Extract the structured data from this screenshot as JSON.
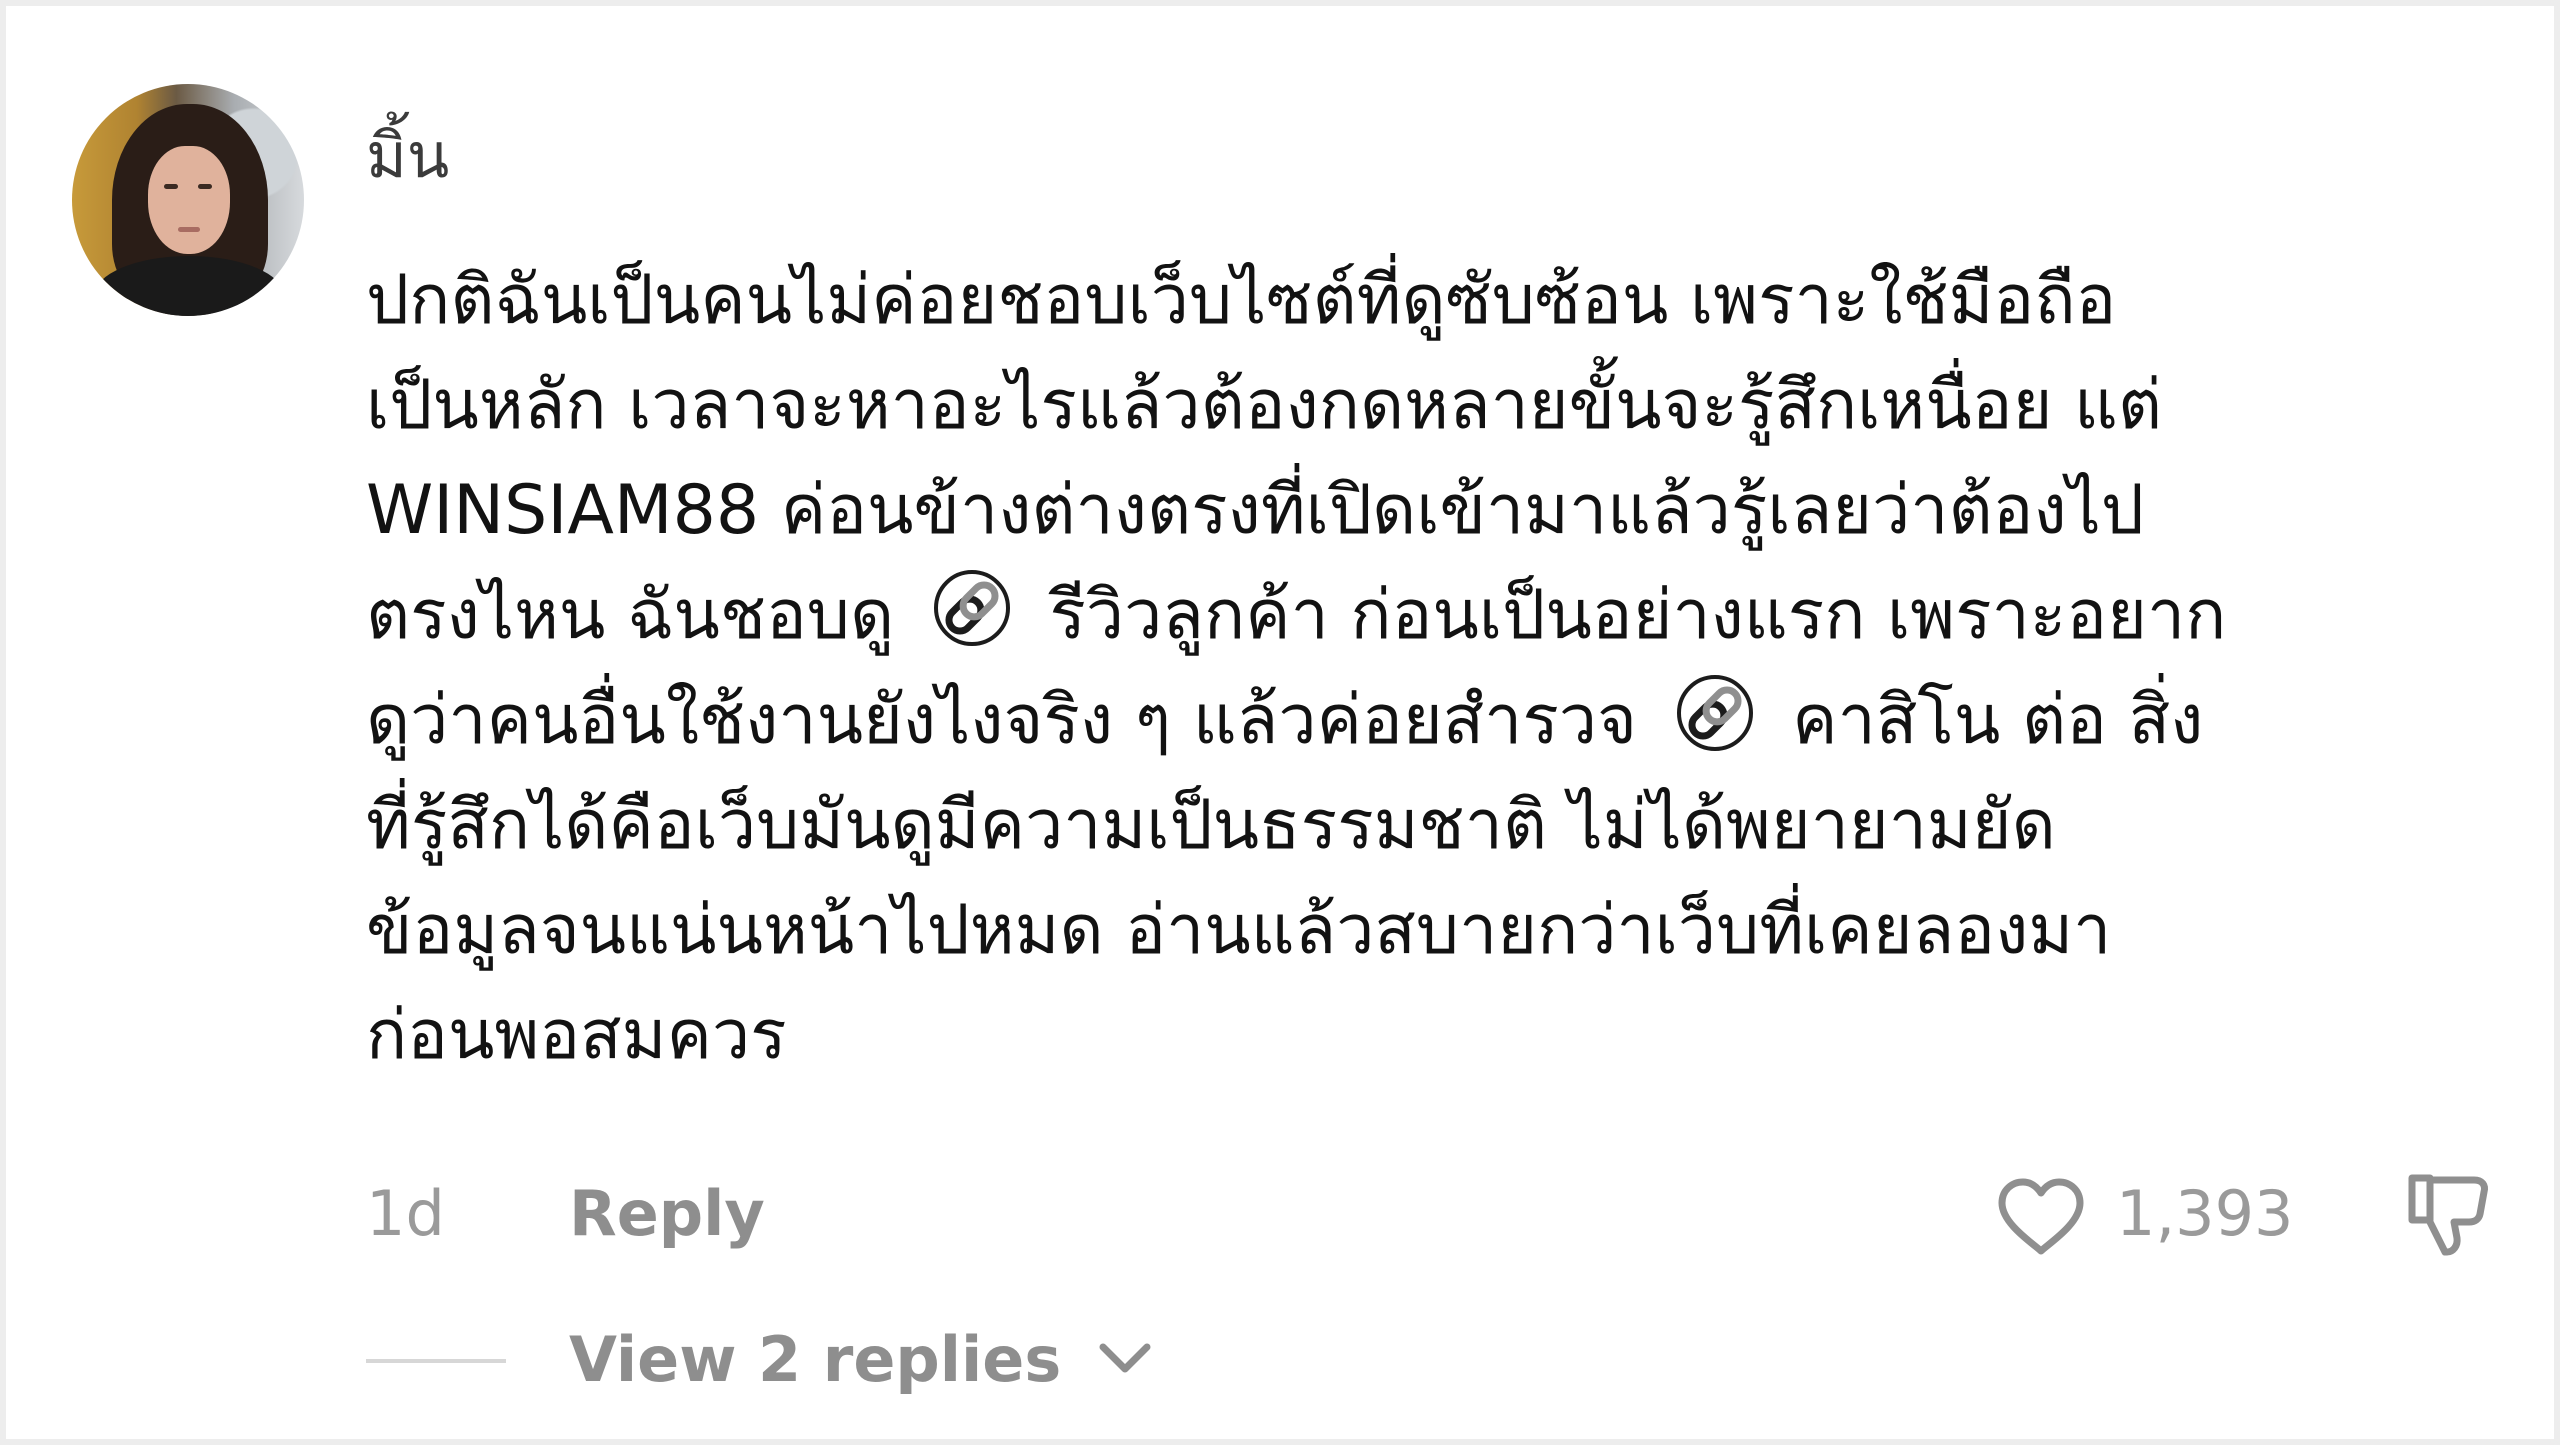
{
  "comment": {
    "author": "มิ้น",
    "avatar_icon": "user-avatar-photo",
    "link_icon": "link-icon",
    "lines": [
      {
        "text": "ปกติฉันเป็นคนไม่ค่อยชอบเว็บไซต์ที่ดูซับซ้อน เพราะใช้มือถือ"
      },
      {
        "text": "เป็นหลัก เวลาจะหาอะไรแล้วต้องกดหลายขั้นจะรู้สึกเหนื่อย แต่"
      },
      {
        "text": "WINSIAM88 ค่อนข้างต่างตรงที่เปิดเข้ามาแล้วรู้เลยว่าต้องไป"
      },
      {
        "before": "ตรงไหน ฉันชอบดู",
        "after": "รีวิวลูกค้า ก่อนเป็นอย่างแรก เพราะอยาก"
      },
      {
        "before": "ดูว่าคนอื่นใช้งานยังไงจริง ๆ แล้วค่อยสำรวจ",
        "after": "คาสิโน ต่อ สิ่ง"
      },
      {
        "text": "ที่รู้สึกได้คือเว็บมันดูมีความเป็นธรรมชาติ ไม่ได้พยายามยัด"
      },
      {
        "text": "ข้อมูลจนแน่นหน้าไปหมด อ่านแล้วสบายกว่าเว็บที่เคยลองมา"
      },
      {
        "text": "ก่อนพอสมควร"
      }
    ],
    "time": "1d",
    "reply_label": "Reply",
    "like_count": "1,393",
    "like_icon": "heart-icon",
    "dislike_icon": "thumbs-down-icon",
    "view_replies_label": "View 2 replies",
    "view_replies_icon": "chevron-down-icon"
  }
}
